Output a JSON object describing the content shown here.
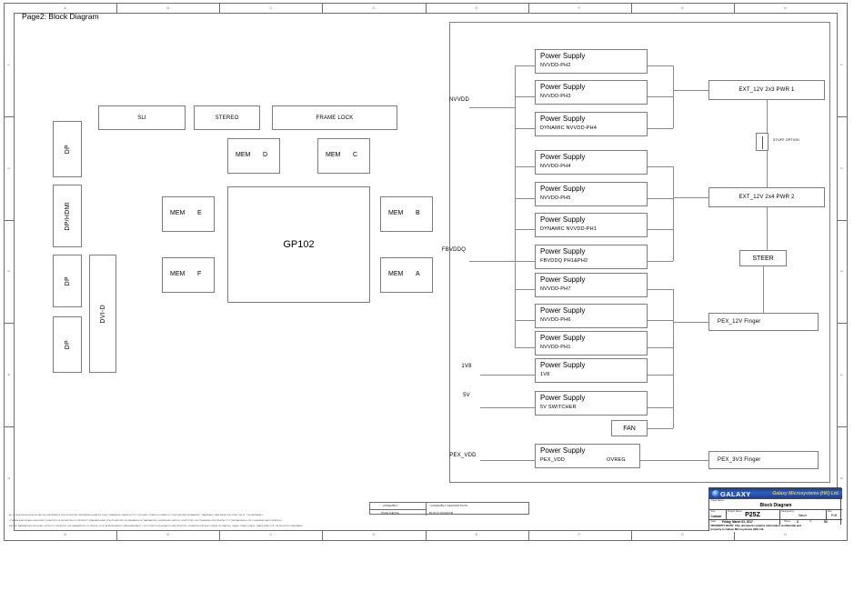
{
  "page_label": "Page2: Block Diagram",
  "frame": {
    "columns": [
      "A",
      "B",
      "C",
      "D",
      "E",
      "F",
      "G",
      "H"
    ],
    "rows": [
      "1",
      "2",
      "3",
      "4",
      "5"
    ]
  },
  "left_blocks": {
    "connectors": [
      {
        "name": "dp-1",
        "label": "DP"
      },
      {
        "name": "dp-hdmi",
        "label": "DP/HDMI"
      },
      {
        "name": "dp-2",
        "label": "DP"
      },
      {
        "name": "dp-3",
        "label": "DP"
      },
      {
        "name": "dvi-d",
        "label": "DVI-D"
      }
    ],
    "top_blocks": [
      {
        "name": "sli",
        "label": "SLI"
      },
      {
        "name": "stereo",
        "label": "STEREO"
      },
      {
        "name": "frame-lock",
        "label": "FRAME LOCK"
      }
    ],
    "gpu": {
      "label": "GP102"
    },
    "memories": [
      {
        "name": "mem-d",
        "label": "MEM",
        "suffix": "D"
      },
      {
        "name": "mem-c",
        "label": "MEM",
        "suffix": "C"
      },
      {
        "name": "mem-e",
        "label": "MEM",
        "suffix": "E"
      },
      {
        "name": "mem-b",
        "label": "MEM",
        "suffix": "B"
      },
      {
        "name": "mem-f",
        "label": "MEM",
        "suffix": "F"
      },
      {
        "name": "mem-a",
        "label": "MEM",
        "suffix": "A"
      }
    ]
  },
  "power": {
    "rail_labels": [
      {
        "name": "nvvdd",
        "label": "NVVDD"
      },
      {
        "name": "fbvddq",
        "label": "FBVDDQ"
      },
      {
        "name": "1v8",
        "label": "1V8"
      },
      {
        "name": "5v",
        "label": "5V"
      },
      {
        "name": "pex-vdd",
        "label": "PEX_VDD"
      }
    ],
    "title": "Power Supply",
    "supplies": [
      {
        "name": "psu-nvvdd-ph2",
        "title": "Power Supply",
        "sub": "NVVDD-PH2"
      },
      {
        "name": "psu-nvvdd-ph3",
        "title": "Power Supply",
        "sub": "NVVDD-PH3"
      },
      {
        "name": "psu-dynamic-nvvdd-ph4",
        "title": "Power Supply",
        "sub": "DYNAMIC NVVDD-PH4"
      },
      {
        "name": "psu-nvvdd-ph4",
        "title": "Power Supply",
        "sub": "NVVDD-PH4"
      },
      {
        "name": "psu-nvvdd-ph5",
        "title": "Power Supply",
        "sub": "NVVDD-PH5"
      },
      {
        "name": "psu-dynamic-nvvdd-ph1",
        "title": "Power Supply",
        "sub": "DYNAMIC NVVDD-PH1"
      },
      {
        "name": "psu-fbvddq-ph1-ph2",
        "title": "Power Supply",
        "sub": "FBVDDQ PH1&PH2"
      },
      {
        "name": "psu-nvvdd-ph7",
        "title": "Power Supply",
        "sub": "NVVDD-PH7"
      },
      {
        "name": "psu-nvvdd-ph6",
        "title": "Power Supply",
        "sub": "NVVDD-PH6"
      },
      {
        "name": "psu-nvvdd-ph1",
        "title": "Power Supply",
        "sub": "NVVDD-PH1"
      },
      {
        "name": "psu-1v8",
        "title": "Power Supply",
        "sub": "1V8"
      },
      {
        "name": "psu-5v-switcher",
        "title": "Power Supply",
        "sub": "5V SWITCHER"
      },
      {
        "name": "psu-pex-vdd",
        "title": "Power Supply",
        "sub": "PEX_VDD",
        "sub2": "OVREG"
      }
    ],
    "fan": "FAN"
  },
  "right_blocks": [
    {
      "name": "ext-12v-2x3-pwr1",
      "label": "EXT_12V 2x3 PWR 1"
    },
    {
      "name": "stuff-option",
      "label": "STUFF OPTION"
    },
    {
      "name": "ext-12v-2x4-pwr2",
      "label": "EXT_12V 2x4 PWR 2"
    },
    {
      "name": "steer",
      "label": "STEER"
    },
    {
      "name": "pex-12v-finger",
      "label": "PEX_12V Finger"
    },
    {
      "name": "pex-3v3-finger",
      "label": "PEX_3V3 Finger"
    }
  ],
  "assembly_table": {
    "col1_line1": "ASSEMBLY",
    "col1_line2": "PAGE DETAIL",
    "col2_line1": "<ASSEMBLY DESCRIPTION>",
    "col2_line2": "BLOCK DIAGRAM"
  },
  "legal_text": [
    "ALL NVIDIA DESIGN SPECIFICATIONS, REFERENCE SPECIFICATIONS, REFERENCE BOARDS, FILES, DRAWINGS, DIAGNOSTICS, LISTS AND OTHER DOCUMENTS (TOGETHER AND SEPARATELY, \"MATERIALS\") ARE BEING PROVIDED \"AS IS.\" THE MATERIALS",
    "CONTAIN ERRORS AND UNKNOWN VIOLATIONS OR DEVIATIONS OF INDUSTRY STANDARDS AND SPECIFICATIONS. NVIDIA MAKES NO WARRANTIES, EXPRESSED, IMPLIED, STATUTORY, OR OTHERWISE WITH RESPECT TO THE MATERIALS, OR OTHERWISE, AND EXPRESSLY",
    "IMPLIED WARRANTIES INCLUDING, WITHOUT LIMITATION, THE WARRANTIES OF DESIGN, OF NONINFRINGEMENT, MERCHANTABILITY OR FITNESS FOR A PARTICULAR PURPOSE, OR ARISING FROM A COURSE OF DEALING, USAGE, TRADE USAGE, TRADE PRACTICE, OR INDUSTRY STANDARDS."
  ],
  "title_block": {
    "logo_text": "GALAXY",
    "company": "Galaxy Microsystems (HK) Ltd.",
    "page_name_key": "Page Name:",
    "page_name_value": "Block Diagram",
    "size_key": "Size",
    "size_value": "Custom",
    "project_key": "Project Name",
    "project_value": "P25Z",
    "designed_key": "Designed by",
    "designed_value": "Nasor",
    "rev_key": "Rev",
    "rev_value": "P1B",
    "date_key": "Date:",
    "date_value": "Friday, March 03, 2017",
    "sheet_key": "Sheet",
    "sheet_value": "2",
    "of_key": "of",
    "of_value": "52",
    "proprietary_line1": "PROPERTY NOTE: This document contains information confidential and",
    "proprietary_line2": "property to Galaxy Microsystems (HK) Ltd."
  }
}
